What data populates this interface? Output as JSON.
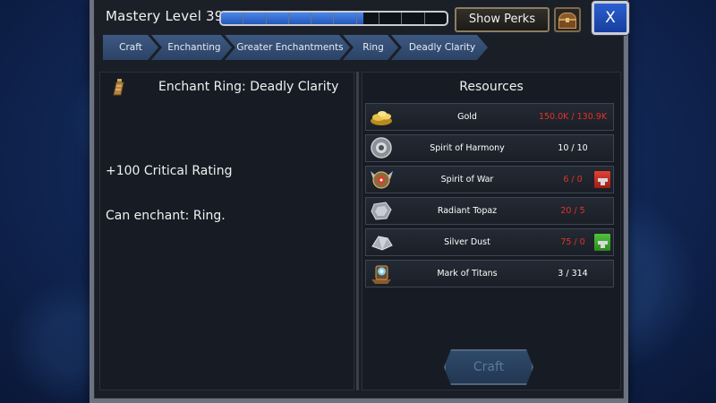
{
  "header": {
    "mastery_label": "Mastery Level 39",
    "xp_progress_fraction": 0.63,
    "xp_segments": 10,
    "show_perks_label": "Show Perks",
    "close_label": "X"
  },
  "breadcrumb": [
    "Craft",
    "Enchanting",
    "Greater Enchantments",
    "Ring",
    "Deadly Clarity"
  ],
  "recipe": {
    "title": "Enchant Ring: Deadly Clarity",
    "stat": "+100 Critical Rating",
    "enchant_target": "Can enchant: Ring.",
    "icon": "enchant-scroll-icon"
  },
  "resources": {
    "title": "Resources",
    "items": [
      {
        "name": "Gold",
        "qty": "150.0K / 130.9K",
        "status": "bad",
        "icon": "gold-coins-icon",
        "shop": null
      },
      {
        "name": "Spirit of Harmony",
        "qty": "10 / 10",
        "status": "ok",
        "icon": "spirit-harmony-icon",
        "shop": null
      },
      {
        "name": "Spirit of War",
        "qty": "6 / 0",
        "status": "bad",
        "icon": "spirit-war-icon",
        "shop": "red"
      },
      {
        "name": "Radiant Topaz",
        "qty": "20 / 5",
        "status": "bad",
        "icon": "radiant-topaz-icon",
        "shop": null
      },
      {
        "name": "Silver Dust",
        "qty": "75 / 0",
        "status": "bad",
        "icon": "silver-dust-icon",
        "shop": "green"
      },
      {
        "name": "Mark of Titans",
        "qty": "3 / 314",
        "status": "ok",
        "icon": "mark-of-titans-icon",
        "shop": null
      }
    ]
  },
  "craft_button_label": "Craft",
  "colors": {
    "insufficient": "#e5312b",
    "sufficient": "#ffffff",
    "xp_fill": "#3a72d8",
    "accent_blue": "#2b5fd0"
  }
}
